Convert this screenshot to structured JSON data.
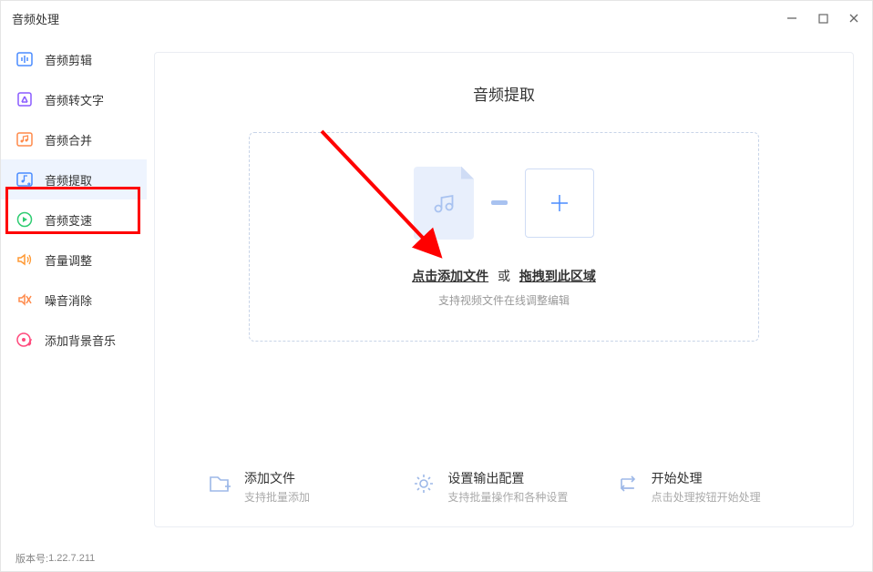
{
  "window": {
    "title": "音频处理"
  },
  "sidebar": {
    "items": [
      {
        "label": "音频剪辑",
        "icon": "audio-cut-icon",
        "color": "#4a8cff"
      },
      {
        "label": "音频转文字",
        "icon": "audio-to-text-icon",
        "color": "#8a5cff"
      },
      {
        "label": "音频合并",
        "icon": "audio-merge-icon",
        "color": "#ff8a4a"
      },
      {
        "label": "音频提取",
        "icon": "audio-extract-icon",
        "color": "#4a8cff"
      },
      {
        "label": "音频变速",
        "icon": "audio-speed-icon",
        "color": "#2ecc71"
      },
      {
        "label": "音量调整",
        "icon": "volume-adjust-icon",
        "color": "#ff9933"
      },
      {
        "label": "噪音消除",
        "icon": "noise-remove-icon",
        "color": "#ff8a4a"
      },
      {
        "label": "添加背景音乐",
        "icon": "bgm-icon",
        "color": "#ff4a7d"
      }
    ],
    "active_index": 3
  },
  "main": {
    "title": "音频提取",
    "drop": {
      "click_text": "点击添加文件",
      "sep": "或",
      "drag_text": "拖拽到此区域",
      "subtext": "支持视频文件在线调整编辑"
    },
    "actions": [
      {
        "title": "添加文件",
        "sub": "支持批量添加"
      },
      {
        "title": "设置输出配置",
        "sub": "支持批量操作和各种设置"
      },
      {
        "title": "开始处理",
        "sub": "点击处理按钮开始处理"
      }
    ]
  },
  "footer": {
    "version_label": "版本号:",
    "version": "1.22.7.211"
  }
}
